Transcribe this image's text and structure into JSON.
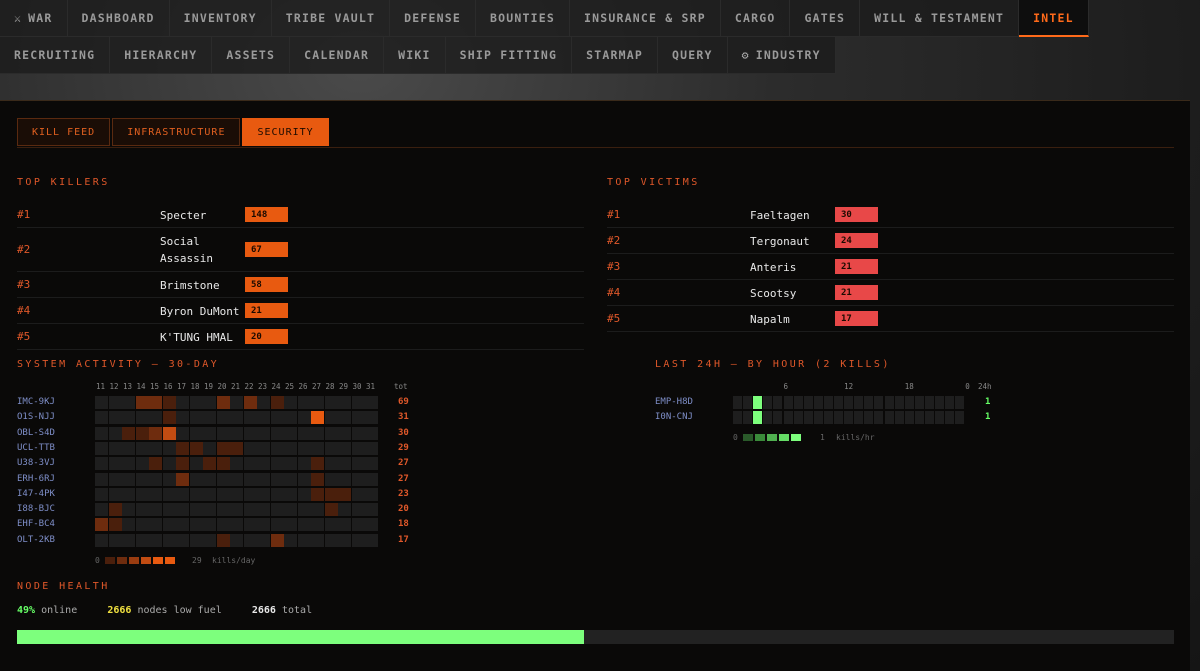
{
  "nav": {
    "row1": [
      {
        "label": "WAR",
        "icon": "crossed-swords-icon"
      },
      {
        "label": "DASHBOARD"
      },
      {
        "label": "INVENTORY"
      },
      {
        "label": "TRIBE VAULT"
      },
      {
        "label": "DEFENSE"
      },
      {
        "label": "BOUNTIES"
      },
      {
        "label": "INSURANCE & SRP"
      },
      {
        "label": "CARGO"
      },
      {
        "label": "GATES"
      },
      {
        "label": "WILL & TESTAMENT"
      },
      {
        "label": "INTEL",
        "active": true
      }
    ],
    "row2": [
      {
        "label": "RECRUITING"
      },
      {
        "label": "HIERARCHY"
      },
      {
        "label": "ASSETS"
      },
      {
        "label": "CALENDAR"
      },
      {
        "label": "WIKI"
      },
      {
        "label": "SHIP FITTING"
      },
      {
        "label": "STARMAP"
      },
      {
        "label": "QUERY"
      },
      {
        "label": "INDUSTRY",
        "icon": "gear-icon"
      }
    ]
  },
  "subtabs": [
    {
      "label": "KILL FEED"
    },
    {
      "label": "INFRASTRUCTURE"
    },
    {
      "label": "SECURITY",
      "active": true
    }
  ],
  "top_killers": {
    "title": "TOP KILLERS",
    "max": 148,
    "rows": [
      {
        "rank": "#1",
        "name": "Specter",
        "value": 148
      },
      {
        "rank": "#2",
        "name": "Social Assassin",
        "value": 67
      },
      {
        "rank": "#3",
        "name": "Brimstone",
        "value": 58
      },
      {
        "rank": "#4",
        "name": "Byron DuMont",
        "value": 21
      },
      {
        "rank": "#5",
        "name": "K'TUNG HMAL",
        "value": 20
      }
    ]
  },
  "top_victims": {
    "title": "TOP VICTIMS",
    "max": 30,
    "rows": [
      {
        "rank": "#1",
        "name": "Faeltagen",
        "value": 30
      },
      {
        "rank": "#2",
        "name": "Tergonaut",
        "value": 24
      },
      {
        "rank": "#3",
        "name": "Anteris",
        "value": 21
      },
      {
        "rank": "#4",
        "name": "Scootsy",
        "value": 21
      },
      {
        "rank": "#5",
        "name": "Napalm",
        "value": 17
      }
    ]
  },
  "system_activity": {
    "title": "SYSTEM ACTIVITY — 30-DAY",
    "days": [
      "11",
      "12",
      "13",
      "14",
      "15",
      "16",
      "17",
      "18",
      "19",
      "20",
      "21",
      "22",
      "23",
      "24",
      "25",
      "26",
      "27",
      "28",
      "29",
      "30",
      "31"
    ],
    "tot_label": "tot",
    "rows": [
      {
        "system": "IMC-9KJ",
        "total": 69,
        "cells": [
          0,
          0,
          0,
          2,
          2,
          1,
          0,
          0,
          0,
          2,
          0,
          2,
          0,
          1,
          0,
          0,
          0,
          0,
          0,
          0,
          0
        ]
      },
      {
        "system": "O1S-NJJ",
        "total": 31,
        "cells": [
          0,
          0,
          0,
          0,
          0,
          1,
          0,
          0,
          0,
          0,
          0,
          0,
          0,
          0,
          0,
          0,
          5,
          0,
          0,
          0,
          0
        ]
      },
      {
        "system": "OBL-S4D",
        "total": 30,
        "cells": [
          0,
          0,
          1,
          1,
          2,
          4,
          0,
          0,
          0,
          0,
          0,
          0,
          0,
          0,
          0,
          0,
          0,
          0,
          0,
          0,
          0
        ]
      },
      {
        "system": "UCL-TTB",
        "total": 29,
        "cells": [
          0,
          0,
          0,
          0,
          0,
          0,
          1,
          1,
          0,
          1,
          1,
          0,
          0,
          0,
          0,
          0,
          0,
          0,
          0,
          0,
          0
        ]
      },
      {
        "system": "U38-3VJ",
        "total": 27,
        "cells": [
          0,
          0,
          0,
          0,
          1,
          0,
          1,
          0,
          1,
          1,
          0,
          0,
          0,
          0,
          0,
          0,
          1,
          0,
          0,
          0,
          0
        ]
      },
      {
        "system": "ERH-6RJ",
        "total": 27,
        "cells": [
          0,
          0,
          0,
          0,
          0,
          0,
          2,
          0,
          0,
          0,
          0,
          0,
          0,
          0,
          0,
          0,
          1,
          0,
          0,
          0,
          0
        ]
      },
      {
        "system": "I47-4PK",
        "total": 23,
        "cells": [
          0,
          0,
          0,
          0,
          0,
          0,
          0,
          0,
          0,
          0,
          0,
          0,
          0,
          0,
          0,
          0,
          1,
          1,
          1,
          0,
          0
        ]
      },
      {
        "system": "I88-BJC",
        "total": 20,
        "cells": [
          0,
          1,
          0,
          0,
          0,
          0,
          0,
          0,
          0,
          0,
          0,
          0,
          0,
          0,
          0,
          0,
          0,
          1,
          0,
          0,
          0
        ]
      },
      {
        "system": "EHF-BC4",
        "total": 18,
        "cells": [
          2,
          1,
          0,
          0,
          0,
          0,
          0,
          0,
          0,
          0,
          0,
          0,
          0,
          0,
          0,
          0,
          0,
          0,
          0,
          0,
          0
        ]
      },
      {
        "system": "OLT-2KB",
        "total": 17,
        "cells": [
          0,
          0,
          0,
          0,
          0,
          0,
          0,
          0,
          0,
          1,
          0,
          0,
          0,
          2,
          0,
          0,
          0,
          0,
          0,
          0,
          0
        ]
      }
    ],
    "legend": {
      "min": "0",
      "max": "29",
      "unit": "kills/day"
    }
  },
  "last_24h": {
    "title": "LAST 24H — BY HOUR (2 KILLS)",
    "hour_ticks": [
      "6",
      "12",
      "18",
      "0"
    ],
    "tot_label": "24h",
    "rows": [
      {
        "system": "EMP-H8D",
        "total": 1,
        "active_hour_index": 2
      },
      {
        "system": "I0N-CNJ",
        "total": 1,
        "active_hour_index": 2
      }
    ],
    "legend": {
      "min": "0",
      "max": "1",
      "unit": "kills/hr"
    }
  },
  "node_health": {
    "title": "NODE HEALTH",
    "online_pct": "49%",
    "online_label": "online",
    "low_fuel_count": "2666",
    "low_fuel_label": "nodes low fuel",
    "total_count": "2666",
    "total_label": "total",
    "online_fraction": 0.49
  },
  "colors": {
    "accent": "#e85a10",
    "victim_bar": "#e84848",
    "green": "#66ff66"
  }
}
